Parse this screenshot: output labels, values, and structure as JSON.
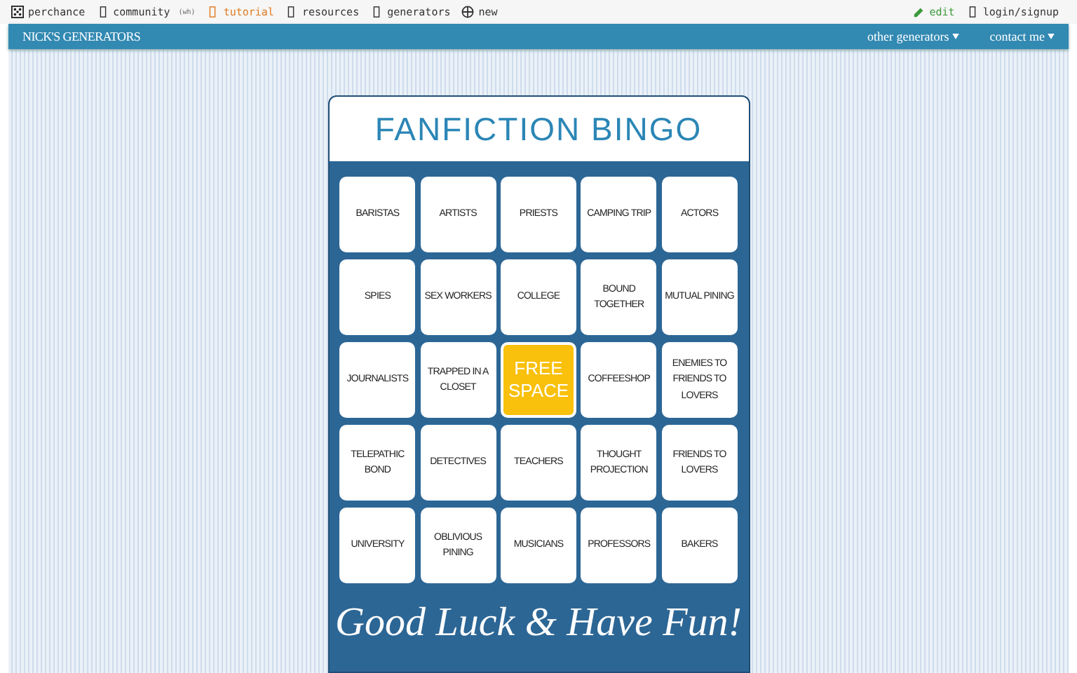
{
  "top_bar": {
    "left": [
      {
        "label": "perchance",
        "kind": "dice",
        "color": "#333333"
      },
      {
        "label": "community",
        "note": "(wh)",
        "kind": "box",
        "color": "#333333"
      },
      {
        "label": "tutorial",
        "kind": "box",
        "color": "#e07b22"
      },
      {
        "label": "resources",
        "kind": "box",
        "color": "#333333"
      },
      {
        "label": "generators",
        "kind": "box",
        "color": "#333333"
      },
      {
        "label": "new",
        "kind": "plus",
        "color": "#333333"
      }
    ],
    "right": [
      {
        "label": "edit",
        "kind": "pencil",
        "color": "#3c9a3c"
      },
      {
        "label": "login/signup",
        "kind": "box",
        "color": "#333333"
      }
    ]
  },
  "header": {
    "title": "NICK'S GENERATORS",
    "menus": [
      "other generators",
      "contact me"
    ]
  },
  "card": {
    "title": "FANFICTION BINGO",
    "footer": "Good Luck & Have Fun!",
    "cells": [
      {
        "kind": "square",
        "text": "BARISTAS"
      },
      {
        "kind": "square",
        "text": "ARTISTS"
      },
      {
        "kind": "square",
        "text": "PRIESTS"
      },
      {
        "kind": "square",
        "text": "CAMPING TRIP"
      },
      {
        "kind": "square",
        "text": "ACTORS"
      },
      {
        "kind": "square",
        "text": "SPIES"
      },
      {
        "kind": "square",
        "text": "SEX WORKERS"
      },
      {
        "kind": "square",
        "text": "COLLEGE"
      },
      {
        "kind": "square",
        "text": "BOUND TOGETHER"
      },
      {
        "kind": "square",
        "text": "MUTUAL PINING"
      },
      {
        "kind": "square",
        "text": "JOURNALISTS"
      },
      {
        "kind": "square",
        "text": "TRAPPED IN A CLOSET"
      },
      {
        "kind": "free",
        "text": "FREE SPACE"
      },
      {
        "kind": "square",
        "text": "COFFEESHOP"
      },
      {
        "kind": "square",
        "text": "ENEMIES TO FRIENDS TO LOVERS"
      },
      {
        "kind": "square",
        "text": "TELEPATHIC BOND"
      },
      {
        "kind": "square",
        "text": "DETECTIVES"
      },
      {
        "kind": "square",
        "text": "TEACHERS"
      },
      {
        "kind": "square",
        "text": "THOUGHT PROJECTION"
      },
      {
        "kind": "square",
        "text": "FRIENDS TO LOVERS"
      },
      {
        "kind": "square",
        "text": "UNIVERSITY"
      },
      {
        "kind": "square",
        "text": "OBLIVIOUS PINING"
      },
      {
        "kind": "square",
        "text": "MUSICIANS"
      },
      {
        "kind": "square",
        "text": "PROFESSORS"
      },
      {
        "kind": "square",
        "text": "BAKERS"
      }
    ]
  }
}
